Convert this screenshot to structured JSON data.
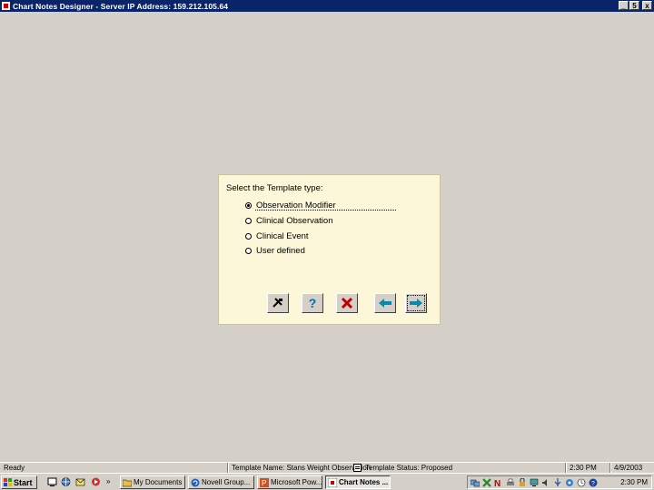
{
  "window": {
    "title": "Chart Notes Designer - Server IP Address: 159.212.105.64",
    "buttons": {
      "minimize": "_",
      "maximize": "5",
      "close": "x"
    }
  },
  "dialog": {
    "label": "Select the Template type:",
    "options": [
      {
        "label": "Observation Modifier",
        "selected": true
      },
      {
        "label": "Clinical Observation",
        "selected": false
      },
      {
        "label": "Clinical Event",
        "selected": false
      },
      {
        "label": "User defined",
        "selected": false
      }
    ],
    "toolbar": [
      {
        "icon": "tools-icon"
      },
      {
        "icon": "help-icon",
        "glyph": "?"
      },
      {
        "icon": "cancel-icon"
      },
      {
        "icon": "back-arrow-icon"
      },
      {
        "icon": "next-arrow-icon"
      }
    ]
  },
  "statusbar": {
    "ready": "Ready",
    "template_name": "Template Name: Stans Weight Observation",
    "template_status": "Template Status: Proposed",
    "time": "2:30 PM",
    "date": "4/9/2003"
  },
  "taskbar": {
    "start": "Start",
    "tasks": [
      {
        "label": "My Documents",
        "active": false
      },
      {
        "label": "Novell Group...",
        "active": false
      },
      {
        "label": "Microsoft Pow...",
        "active": false
      },
      {
        "label": "Chart Notes ...",
        "active": true
      }
    ],
    "tray_time": "2:30 PM"
  },
  "colors": {
    "titlebar": "#0a246a",
    "panel": "#fbf7d8",
    "desktop": "#d4d0c8",
    "cancel_red": "#c00000",
    "arrow_teal": "#0a8aa8"
  }
}
